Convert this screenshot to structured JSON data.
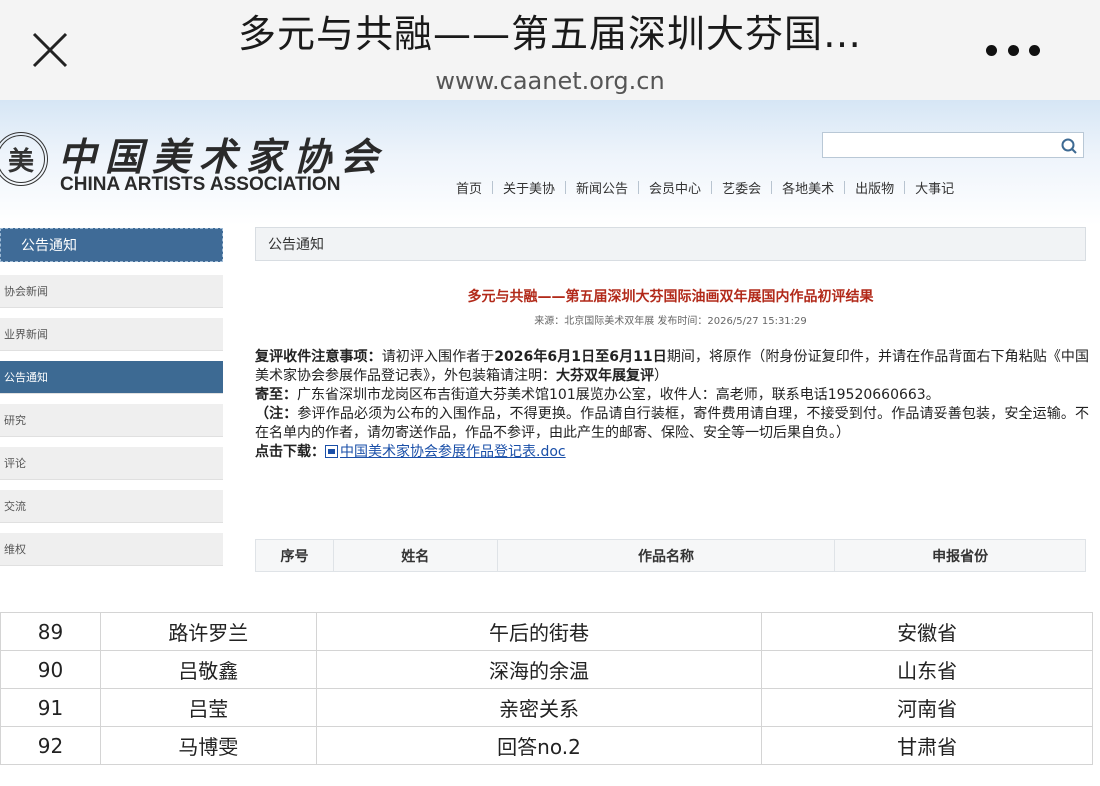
{
  "browser": {
    "title": "多元与共融——第五届深圳大芬国…",
    "url": "www.caanet.org.cn"
  },
  "site": {
    "logo_seal": "美",
    "logo_cn": "中国美术家协会",
    "logo_en": "CHINA ARTISTS ASSOCIATION",
    "search_placeholder": "",
    "nav": [
      "首页",
      "关于美协",
      "新闻公告",
      "会员中心",
      "艺委会",
      "各地美术",
      "出版物",
      "大事记"
    ]
  },
  "sidebar": {
    "header": "公告通知",
    "items": [
      {
        "label": "协会新闻",
        "active": false
      },
      {
        "label": "业界新闻",
        "active": false
      },
      {
        "label": "公告通知",
        "active": true
      },
      {
        "label": "研究",
        "active": false
      },
      {
        "label": "评论",
        "active": false
      },
      {
        "label": "交流",
        "active": false
      },
      {
        "label": "维权",
        "active": false
      }
    ]
  },
  "content": {
    "breadcrumb": "公告通知",
    "article_title": "多元与共融——第五届深圳大芬国际油画双年展国内作品初评结果",
    "article_meta": "来源：北京国际美术双年展 发布时间：2026/5/27 15:31:29",
    "p1_label": "复评收件注意事项：",
    "p1_text_a": "请初评入围作者于",
    "p1_dates": "2026年6月1日至6月11日",
    "p1_text_b": "期间，将原作（附身份证复印件，并请在作品背面右下角粘贴《中国美术家协会参展作品登记表》，外包装箱请注明：",
    "p1_emphasis": "大芬双年展复评",
    "p1_text_c": "）",
    "p2_label": "寄至：",
    "p2_text": "广东省深圳市龙岗区布吉街道大芬美术馆101展览办公室，收件人：高老师，联系电话19520660663。",
    "p3_label": "（注：",
    "p3_text": "参评作品必须为公布的入围作品，不得更换。作品请自行装框，寄件费用请自理，不接受到付。作品请妥善包装，安全运输。不在名单内的作者，请勿寄送作品，作品不参评，由此产生的邮寄、保险、安全等一切后果自负。）",
    "download_label": "点击下载：",
    "download_link": "中国美术家协会参展作品登记表.doc"
  },
  "table": {
    "headers": [
      "序号",
      "姓名",
      "作品名称",
      "申报省份"
    ],
    "rows": [
      [
        "89",
        "路许罗兰",
        "午后的街巷",
        "安徽省"
      ],
      [
        "90",
        "吕敬鑫",
        "深海的余温",
        "山东省"
      ],
      [
        "91",
        "吕莹",
        "亲密关系",
        "河南省"
      ],
      [
        "92",
        "马博雯",
        "回答no.2",
        "甘肃省"
      ]
    ]
  },
  "colors": {
    "accent": "#3d6a93",
    "title_red": "#b22a1a",
    "link_blue": "#1a4fa8"
  }
}
